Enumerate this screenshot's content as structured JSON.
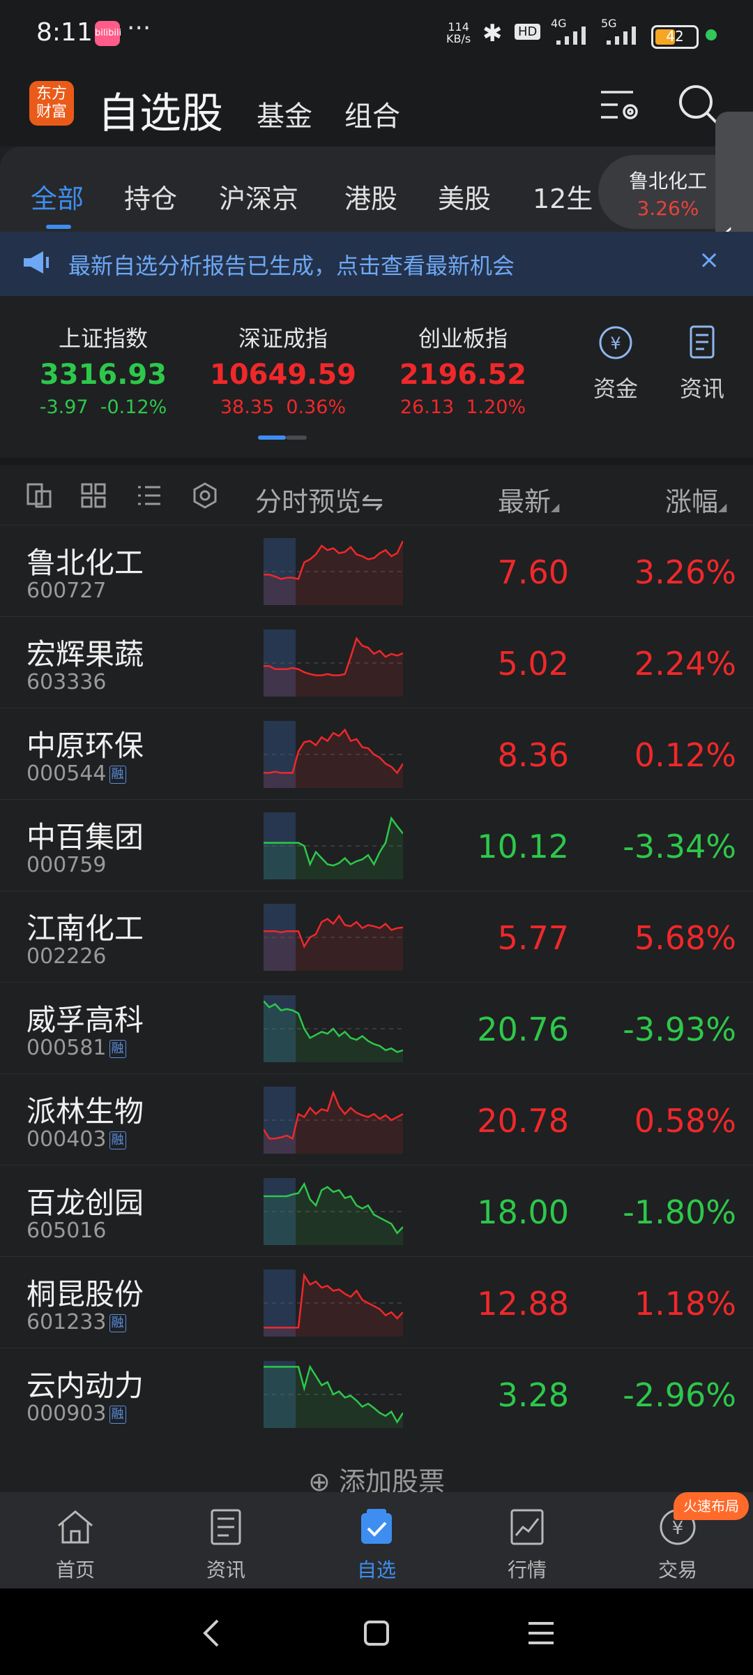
{
  "status_bar": {
    "time": "8:11",
    "app_badge": "bilibili",
    "more": "···",
    "net_speed": "114",
    "net_unit": "KB/s",
    "hd": "HD",
    "sig1_label": "4G",
    "sig2_label": "5G",
    "battery": "42"
  },
  "header": {
    "logo_line1": "东方",
    "logo_line2": "财富",
    "title": "自选股",
    "sub1": "基金",
    "sub2": "组合"
  },
  "tabs": [
    "全部",
    "持仓",
    "沪深京",
    "港股",
    "美股",
    "12生"
  ],
  "float_quote": {
    "name": "鲁北化工",
    "pct": "3.26%"
  },
  "side_handle": "‹",
  "banner": {
    "text": "最新自选分析报告已生成，点击查看最新机会",
    "close": "×"
  },
  "indices": [
    {
      "name": "上证指数",
      "value": "3316.93",
      "change": "-3.97",
      "pct": "-0.12%",
      "dir": "down"
    },
    {
      "name": "深证成指",
      "value": "10649.59",
      "change": "38.35",
      "pct": "0.36%",
      "dir": "up"
    },
    {
      "name": "创业板指",
      "value": "2196.52",
      "change": "26.13",
      "pct": "1.20%",
      "dir": "up"
    }
  ],
  "quick": [
    {
      "label": "资金",
      "icon": "yuan-circle-icon"
    },
    {
      "label": "资讯",
      "icon": "document-icon"
    }
  ],
  "list_header": {
    "preview": "分时预览",
    "preview_icon": "⇋",
    "latest": "最新",
    "pct": "涨幅"
  },
  "stocks": [
    {
      "name": "鲁北化工",
      "code": "600727",
      "rong": false,
      "price": "7.60",
      "pct": "3.26%",
      "dir": "up",
      "spark": [
        0.45,
        0.45,
        0.42,
        0.38,
        0.4,
        0.4,
        0.38,
        0.65,
        0.7,
        0.78,
        0.92,
        0.85,
        0.88,
        0.8,
        0.82,
        0.9,
        0.78,
        0.75,
        0.7,
        0.72,
        0.8,
        0.85,
        0.75,
        0.8,
        1.0
      ]
    },
    {
      "name": "宏辉果蔬",
      "code": "603336",
      "rong": false,
      "price": "5.02",
      "pct": "2.24%",
      "dir": "up",
      "spark": [
        0.45,
        0.45,
        0.4,
        0.4,
        0.4,
        0.42,
        0.4,
        0.35,
        0.32,
        0.3,
        0.3,
        0.32,
        0.3,
        0.3,
        0.32,
        0.6,
        0.9,
        0.78,
        0.75,
        0.65,
        0.7,
        0.6,
        0.65,
        0.62,
        0.66
      ]
    },
    {
      "name": "中原环保",
      "code": "000544",
      "rong": true,
      "price": "8.36",
      "pct": "0.12%",
      "dir": "up",
      "spark": [
        0.2,
        0.2,
        0.22,
        0.2,
        0.2,
        0.2,
        0.55,
        0.7,
        0.72,
        0.65,
        0.78,
        0.72,
        0.85,
        0.8,
        0.9,
        0.72,
        0.75,
        0.62,
        0.6,
        0.5,
        0.45,
        0.35,
        0.3,
        0.2,
        0.35
      ]
    },
    {
      "name": "中百集团",
      "code": "000759",
      "rong": false,
      "price": "10.12",
      "pct": "-3.34%",
      "dir": "down",
      "spark": [
        0.55,
        0.55,
        0.55,
        0.55,
        0.55,
        0.55,
        0.55,
        0.5,
        0.2,
        0.4,
        0.3,
        0.2,
        0.18,
        0.22,
        0.3,
        0.2,
        0.25,
        0.28,
        0.35,
        0.2,
        0.4,
        0.55,
        0.95,
        0.82,
        0.7
      ]
    },
    {
      "name": "江南化工",
      "code": "002226",
      "rong": false,
      "price": "5.77",
      "pct": "5.68%",
      "dir": "up",
      "spark": [
        0.6,
        0.6,
        0.6,
        0.58,
        0.6,
        0.6,
        0.6,
        0.35,
        0.5,
        0.55,
        0.75,
        0.8,
        0.72,
        0.85,
        0.7,
        0.68,
        0.75,
        0.65,
        0.7,
        0.68,
        0.65,
        0.72,
        0.62,
        0.65,
        0.66
      ]
    },
    {
      "name": "威孚高科",
      "code": "000581",
      "rong": true,
      "price": "20.76",
      "pct": "-3.93%",
      "dir": "down",
      "spark": [
        0.95,
        0.85,
        0.9,
        0.8,
        0.82,
        0.8,
        0.75,
        0.5,
        0.35,
        0.4,
        0.45,
        0.42,
        0.5,
        0.38,
        0.45,
        0.35,
        0.32,
        0.38,
        0.3,
        0.25,
        0.22,
        0.15,
        0.18,
        0.12,
        0.15
      ]
    },
    {
      "name": "派林生物",
      "code": "000403",
      "rong": true,
      "price": "20.78",
      "pct": "0.58%",
      "dir": "up",
      "spark": [
        0.35,
        0.2,
        0.2,
        0.22,
        0.25,
        0.2,
        0.6,
        0.55,
        0.7,
        0.6,
        0.68,
        0.65,
        0.95,
        0.72,
        0.6,
        0.7,
        0.62,
        0.58,
        0.55,
        0.6,
        0.52,
        0.58,
        0.5,
        0.55,
        0.6
      ]
    },
    {
      "name": "百龙创园",
      "code": "605016",
      "rong": false,
      "price": "18.00",
      "pct": "-1.80%",
      "dir": "down",
      "spark": [
        0.75,
        0.75,
        0.75,
        0.75,
        0.75,
        0.78,
        0.8,
        0.95,
        0.7,
        0.6,
        0.85,
        0.9,
        0.82,
        0.85,
        0.72,
        0.75,
        0.6,
        0.55,
        0.6,
        0.45,
        0.4,
        0.35,
        0.3,
        0.15,
        0.25
      ]
    },
    {
      "name": "桐昆股份",
      "code": "601233",
      "rong": true,
      "price": "12.88",
      "pct": "1.18%",
      "dir": "up",
      "spark": [
        0.1,
        0.1,
        0.1,
        0.1,
        0.1,
        0.1,
        0.1,
        0.95,
        0.8,
        0.85,
        0.75,
        0.78,
        0.7,
        0.72,
        0.65,
        0.6,
        0.7,
        0.55,
        0.5,
        0.45,
        0.4,
        0.3,
        0.35,
        0.25,
        0.35
      ]
    },
    {
      "name": "云内动力",
      "code": "000903",
      "rong": true,
      "price": "3.28",
      "pct": "-2.96%",
      "dir": "down",
      "spark": [
        0.95,
        0.95,
        0.95,
        0.95,
        0.95,
        0.95,
        0.95,
        0.6,
        0.95,
        0.8,
        0.65,
        0.7,
        0.5,
        0.55,
        0.45,
        0.48,
        0.4,
        0.3,
        0.35,
        0.28,
        0.2,
        0.15,
        0.22,
        0.05,
        0.2
      ]
    }
  ],
  "rong_label": "融",
  "add_stock": "添加股票",
  "bottom_nav": [
    {
      "label": "首页",
      "icon": "home-icon"
    },
    {
      "label": "资讯",
      "icon": "news-icon"
    },
    {
      "label": "自选",
      "icon": "watchlist-icon",
      "active": true
    },
    {
      "label": "行情",
      "icon": "chart-icon"
    },
    {
      "label": "交易",
      "icon": "yuan-circle-icon"
    }
  ],
  "promo": "火速布局",
  "colors": {
    "up": "#f0282a",
    "down": "#2dc84b",
    "accent": "#3d8ef0"
  }
}
